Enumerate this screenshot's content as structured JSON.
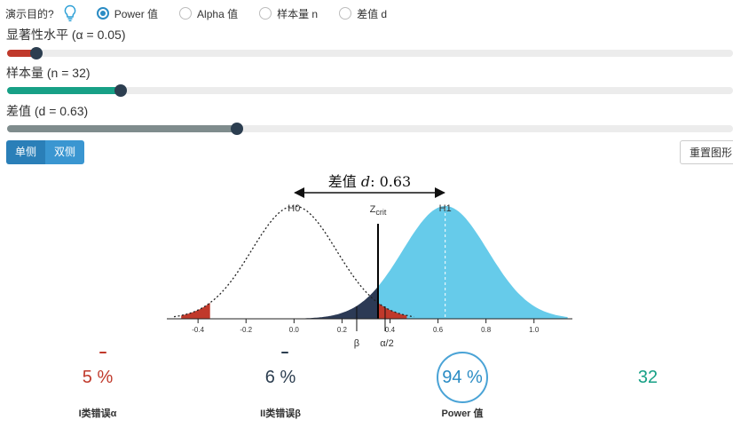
{
  "header": {
    "purpose_label": "演示目的?",
    "options": [
      {
        "label": "Power 值",
        "selected": true
      },
      {
        "label": "Alpha 值",
        "selected": false
      },
      {
        "label": "样本量 n",
        "selected": false
      },
      {
        "label": "差值 d",
        "selected": false
      }
    ]
  },
  "sliders": [
    {
      "label": "显著性水平 (α = 0.05)",
      "value": 0.05,
      "fraction": 0.04,
      "color": "#c0392b"
    },
    {
      "label": "样本量 (n = 32)",
      "value": 32,
      "fraction": 0.157,
      "color": "#17a086"
    },
    {
      "label": "差值 (d = 0.63)",
      "value": 0.63,
      "fraction": 0.317,
      "color": "#7f8c8d"
    }
  ],
  "buttons": {
    "one_sided": "单侧",
    "two_sided": "双侧",
    "reset": "重置图形"
  },
  "chart_data": {
    "type": "area",
    "d": 0.63,
    "d_label": "差值",
    "d_var": "d",
    "d_value_text": ": 0.63",
    "h0_label": "H0",
    "h1_label": "H1",
    "zcrit_label": "Z",
    "zcrit_sub": "crit",
    "beta_label": "β",
    "alpha_label": "α/2",
    "zcrit": 0.35,
    "sd": 0.177,
    "xlim": [
      -0.53,
      1.16
    ],
    "ticks": [
      -0.4,
      -0.2,
      0.0,
      0.2,
      0.4,
      0.6,
      0.8,
      1.0
    ],
    "tick_labels": [
      "-0.4",
      "-0.2",
      "0.0",
      "0.2",
      "0.4",
      "0.6",
      "0.8",
      "1.0"
    ],
    "colors": {
      "h1_fill": "#66cbea",
      "beta_fill": "#2c3a55",
      "alpha_fill": "#c0392b"
    }
  },
  "stats": [
    {
      "value": "5 %",
      "label": "I类错误α",
      "color": "#c0392b"
    },
    {
      "value": "6 %",
      "label": "II类错误β",
      "color": "#2c3e50"
    },
    {
      "value": "94 %",
      "label": "Power 值",
      "color": "#2b8cc4"
    },
    {
      "value": "32",
      "label": "",
      "color": "#17a086"
    }
  ]
}
